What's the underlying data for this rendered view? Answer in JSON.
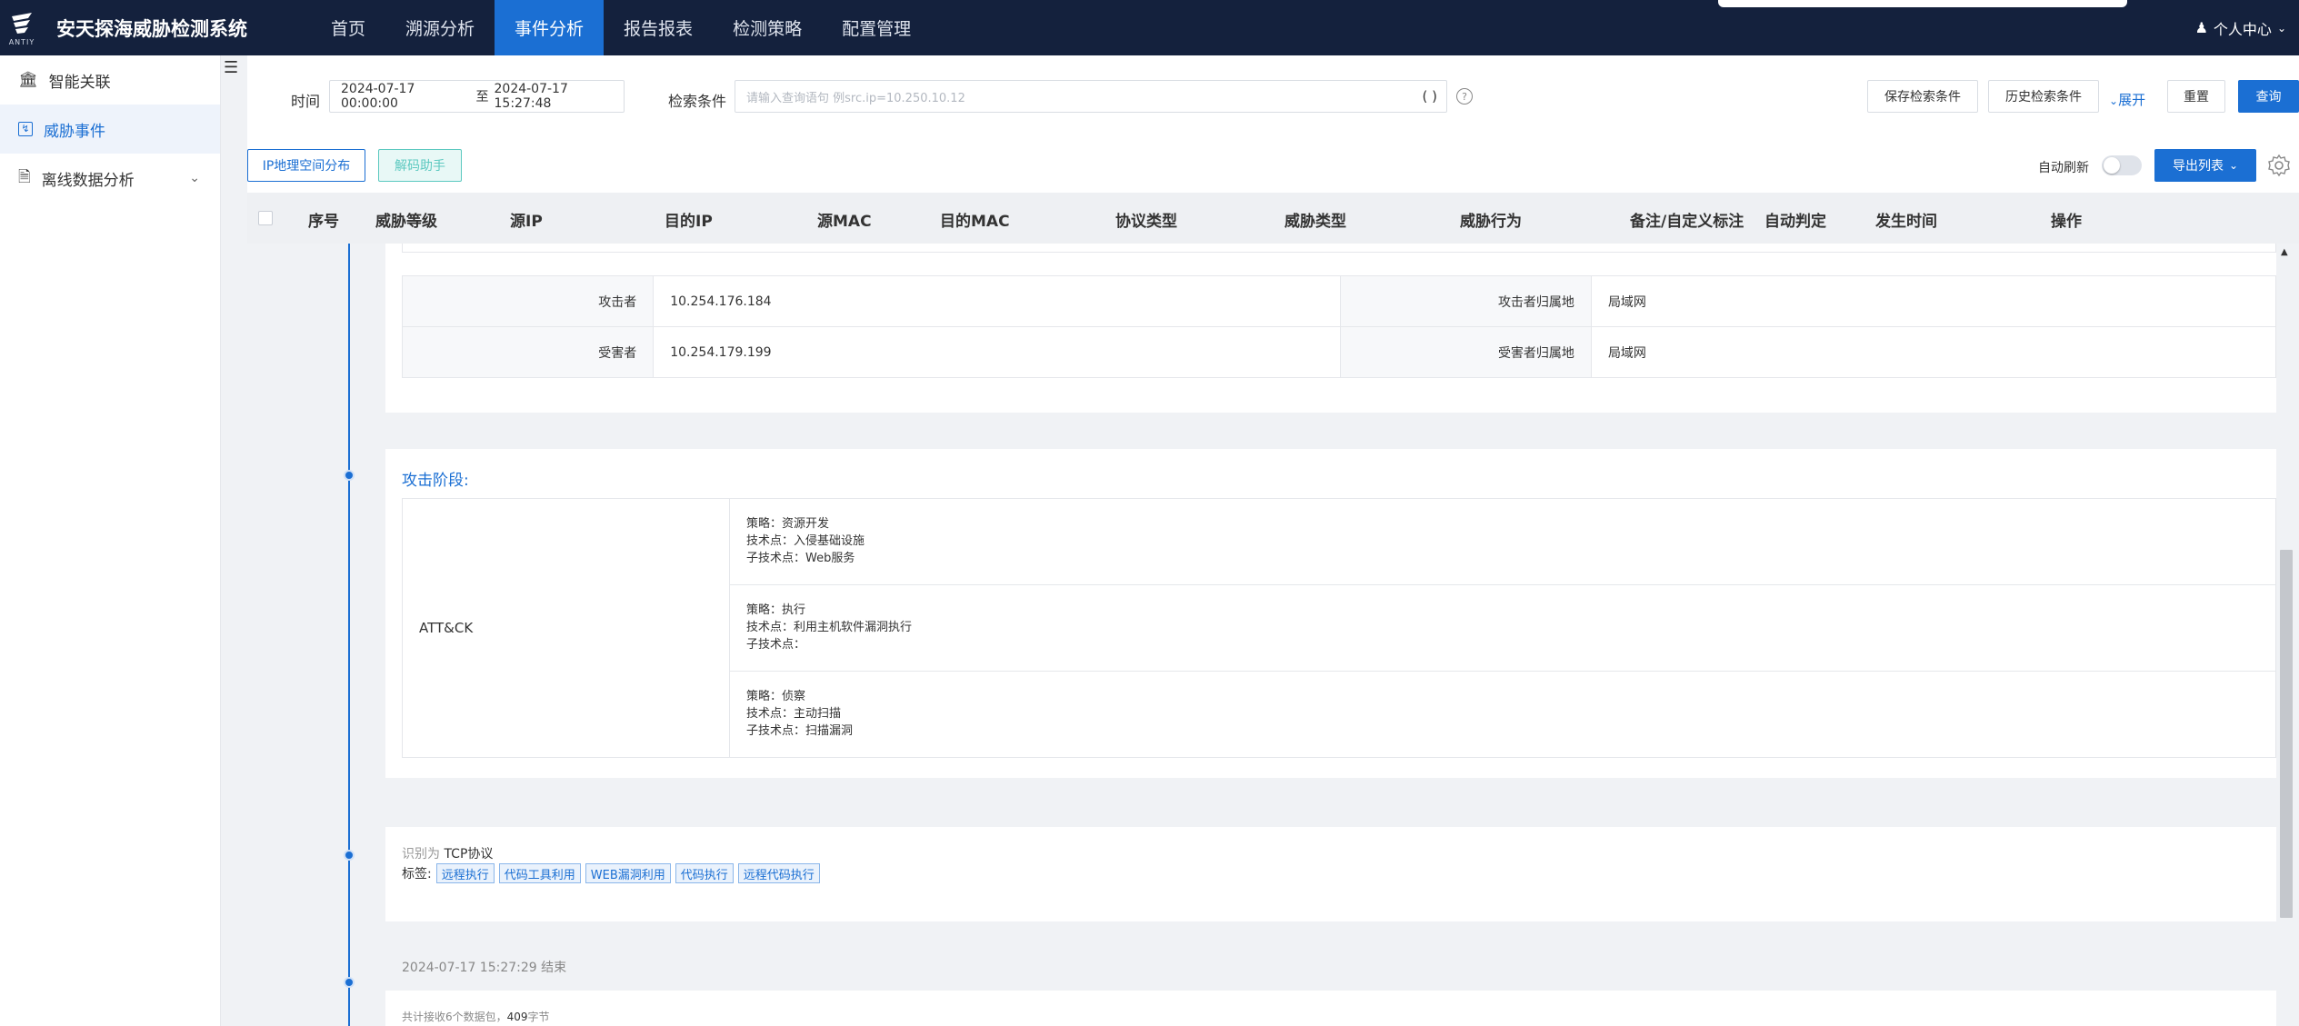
{
  "app": {
    "logo_text": "ANTIY",
    "title": "安天探海威胁检测系统",
    "user_center": "个人中心"
  },
  "nav": [
    {
      "label": "首页",
      "active": false
    },
    {
      "label": "溯源分析",
      "active": false
    },
    {
      "label": "事件分析",
      "active": true
    },
    {
      "label": "报告报表",
      "active": false
    },
    {
      "label": "检测策略",
      "active": false
    },
    {
      "label": "配置管理",
      "active": false
    }
  ],
  "sidebar": {
    "items": [
      {
        "label": "智能关联",
        "icon": "bank-icon",
        "active": false
      },
      {
        "label": "威胁事件",
        "icon": "bolt-icon",
        "active": true
      },
      {
        "label": "离线数据分析",
        "icon": "document-icon",
        "active": false
      }
    ]
  },
  "search": {
    "time_label": "时间",
    "time_start": "2024-07-17 00:00:00",
    "time_sep": "至",
    "time_end": "2024-07-17 15:27:48",
    "cond_label": "检索条件",
    "cond_placeholder": "请输入查询语句 例src.ip=10.250.10.12",
    "paren": "( )",
    "save_btn": "保存检索条件",
    "history_btn": "历史检索条件",
    "expand": "展开",
    "reset_btn": "重置",
    "query_btn": "查询"
  },
  "toolbar": {
    "geo_btn": "IP地理空间分布",
    "decode_btn": "解码助手",
    "auto_refresh": "自动刷新",
    "export_btn": "导出列表"
  },
  "table": {
    "headers": [
      "序号",
      "威胁等级",
      "源IP",
      "目的IP",
      "源MAC",
      "目的MAC",
      "协议类型",
      "威胁类型",
      "威胁行为",
      "备注/自定义标注",
      "自动判定",
      "发生时间",
      "操作"
    ]
  },
  "detail": {
    "kv": [
      {
        "k1": "攻击者",
        "v1": "10.254.176.184",
        "k2": "攻击者归属地",
        "v2": "局域网"
      },
      {
        "k1": "受害者",
        "v1": "10.254.179.199",
        "k2": "受害者归属地",
        "v2": "局域网"
      }
    ],
    "stage_title": "攻击阶段:",
    "attck_label": "ATT&CK",
    "attck_rows": [
      {
        "strategy": "策略：资源开发",
        "technique": "技术点：入侵基础设施",
        "sub": "子技术点：Web服务"
      },
      {
        "strategy": "策略：执行",
        "technique": "技术点：利用主机软件漏洞执行",
        "sub": "子技术点："
      },
      {
        "strategy": "策略：侦察",
        "technique": "技术点：主动扫描",
        "sub": "子技术点：扫描漏洞"
      }
    ],
    "proto_prefix": "识别为",
    "proto_value": "TCP协议",
    "tags_label": "标签:",
    "tags": [
      "远程执行",
      "代码工具利用",
      "WEB漏洞利用",
      "代码执行",
      "远程代码执行"
    ],
    "end_time": "2024-07-17 15:27:29 结束",
    "summary_prefix": "共计接收6个数据包，",
    "summary_bytes": "409",
    "summary_suffix": "字节"
  },
  "colors": {
    "topbar": "#14213d",
    "accent": "#1b6fd3",
    "teal": "#5cc9c0"
  }
}
